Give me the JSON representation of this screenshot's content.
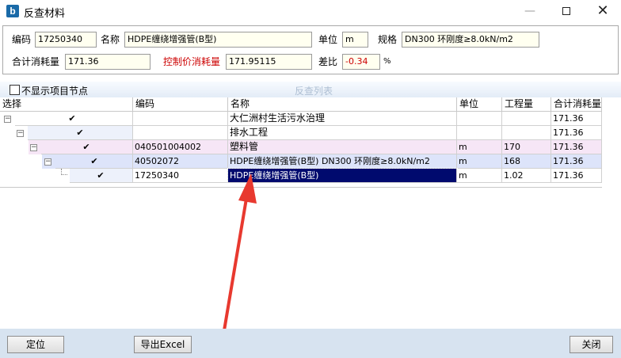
{
  "window": {
    "title": "反查材料",
    "app_icon_glyph": "b"
  },
  "form": {
    "code_label": "编码",
    "code_value": "17250340",
    "name_label": "名称",
    "name_value": "HDPE缠绕增强管(B型)",
    "unit_label": "单位",
    "unit_value": "m",
    "spec_label": "规格",
    "spec_value": "DN300 环刚度≥8.0kN/m2",
    "total_label": "合计消耗量",
    "total_value": "171.36",
    "control_label": "控制价消耗量",
    "control_value": "171.95115",
    "diff_label": "差比",
    "diff_value": "-0.34",
    "diff_unit": "%"
  },
  "list": {
    "hide_nodes_label": "不显示项目节点",
    "caption": "反查列表",
    "columns": [
      "选择",
      "编码",
      "名称",
      "单位",
      "工程量",
      "合计消耗量"
    ],
    "rows": [
      {
        "code": "",
        "name": "大仁洲村生活污水治理",
        "unit": "",
        "qty": "",
        "total": "171.36",
        "checked": "✔",
        "expander": "−"
      },
      {
        "code": "",
        "name": "排水工程",
        "unit": "",
        "qty": "",
        "total": "171.36",
        "checked": "✔",
        "expander": "−"
      },
      {
        "code": "040501004002",
        "name": "塑料管",
        "unit": "m",
        "qty": "170",
        "total": "171.36",
        "checked": "✔",
        "expander": "−"
      },
      {
        "code": "40502072",
        "name": "HDPE缠绕增强管(B型) DN300 环刚度≥8.0kN/m2",
        "unit": "m",
        "qty": "168",
        "total": "171.36",
        "checked": "✔",
        "expander": "−"
      },
      {
        "code": "17250340",
        "name": "HDPE缠绕增强管(B型)",
        "unit": "m",
        "qty": "1.02",
        "total": "171.36",
        "checked": "✔",
        "expander": ""
      }
    ]
  },
  "buttons": {
    "locate": "定位",
    "export": "导出Excel",
    "close": "关闭"
  },
  "colors": {
    "row_tint_2": "#f6e6f6",
    "row_tint_3": "#dde4fa",
    "arrow": "#e8392f",
    "selection": "#000a6e"
  }
}
